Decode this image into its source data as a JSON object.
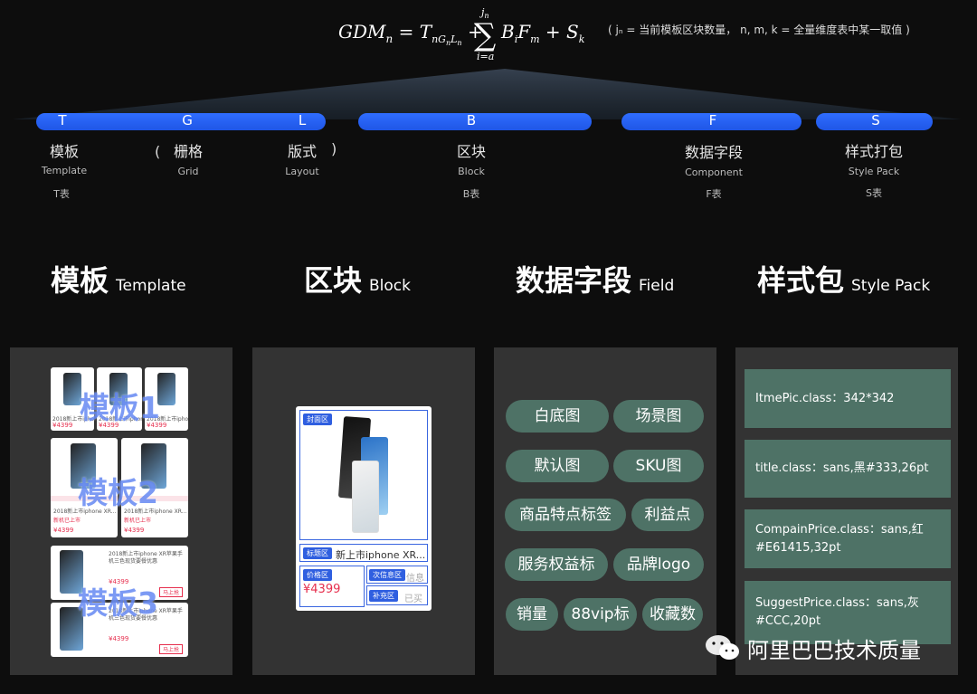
{
  "formula": {
    "lhs_main": "GDM",
    "lhs_sub": "n",
    "t_main": "T",
    "t_sub1": "n",
    "t_sub2": "G",
    "t_sub3": "n",
    "t_sub4": "L",
    "t_sub5": "n",
    "sum_top": "j",
    "sum_top_sub": "n",
    "sum_bottom": "i=a",
    "b_main": "B",
    "b_sub": "i",
    "f_main": "F",
    "f_sub": "m",
    "s_main": "S",
    "s_sub": "k",
    "note": "( jₙ = 当前模板区块数量， n, m, k = 全量维度表中某一取值 )"
  },
  "dimensions": [
    {
      "letter": "T",
      "cn": "模板",
      "en": "Template",
      "table": "T表"
    },
    {
      "letter": "G",
      "cn": "栅格",
      "en": "Grid",
      "table": ""
    },
    {
      "letter": "L",
      "cn": "版式",
      "en": "Layout",
      "table": ""
    },
    {
      "letter": "B",
      "cn": "区块",
      "en": "Block",
      "table": "B表"
    },
    {
      "letter": "F",
      "cn": "数据字段",
      "en": "Component",
      "table": "F表"
    },
    {
      "letter": "S",
      "cn": "样式打包",
      "en": "Style Pack",
      "table": "S表"
    }
  ],
  "parens": {
    "open": "(",
    "close": ")"
  },
  "headings": [
    {
      "cn": "模板",
      "en": "Template"
    },
    {
      "cn": "区块",
      "en": "Block"
    },
    {
      "cn": "数据字段",
      "en": "Field"
    },
    {
      "cn": "样式包",
      "en": "Style Pack"
    }
  ],
  "template_panel": {
    "overlay_1": "模板1",
    "overlay_2": "模板2",
    "overlay_3": "模板3",
    "price": "¥4399",
    "item_title": "2018新上市iphone XR苹果手机三色现货要餐优惠",
    "item_title_short": "2018新上市iphone XR...",
    "badge": "新机已上市",
    "button": "马上抢"
  },
  "block_panel": {
    "cover_label": "封面区",
    "title_label": "标题区",
    "title_text": "新上市iphone XR...",
    "price_label": "价格区",
    "price_text": "¥4399",
    "secondary_label": "次信息区",
    "secondary_text": "信息",
    "supplement_label": "补充区",
    "supplement_text": "已买"
  },
  "field_tags": [
    "白底图",
    "场景图",
    "默认图",
    "SKU图",
    "商品特点标签",
    "利益点",
    "服务权益标",
    "品牌logo",
    "销量",
    "88vip标",
    "收藏数"
  ],
  "style_items": [
    "ItmePic.class：342*342",
    "title.class：sans,黑#333,26pt",
    "CompainPrice.class：sans,红 #E61415,32pt",
    "SuggestPrice.class：sans,灰 #CCC,20pt"
  ],
  "watermark": "阿里巴巴技术质量",
  "colors": {
    "accent_blue": "#2f6dff",
    "tag_green": "#4e7266",
    "panel_gray": "#333333",
    "price_red": "#e62e4d"
  }
}
